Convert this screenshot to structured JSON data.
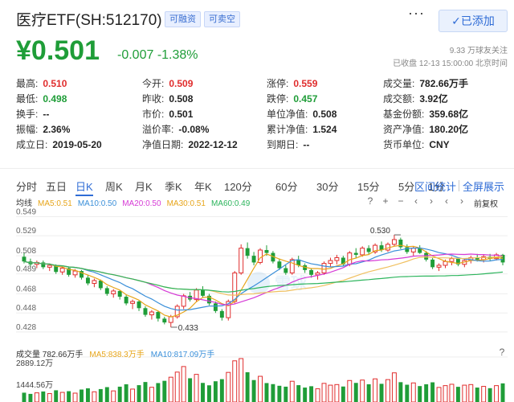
{
  "header": {
    "title": "医疗ETF(SH:512170)",
    "tags": [
      "可融资",
      "可卖空"
    ],
    "more_label": "···",
    "added_label": "✓已添加"
  },
  "quote": {
    "price": "¥0.501",
    "change": "-0.007",
    "change_pct": "-1.38%",
    "followers": "9.33 万球友关注",
    "status": "已收盘 12-13 15:00:00 北京时间"
  },
  "stats": [
    [
      {
        "label": "最高:",
        "value": "0.510",
        "tone": "red"
      },
      {
        "label": "今开:",
        "value": "0.509",
        "tone": "red"
      },
      {
        "label": "涨停:",
        "value": "0.559",
        "tone": "red"
      },
      {
        "label": "成交量:",
        "value": "782.66万手",
        "tone": "dark"
      }
    ],
    [
      {
        "label": "最低:",
        "value": "0.498",
        "tone": "green"
      },
      {
        "label": "昨收:",
        "value": "0.508",
        "tone": "dark"
      },
      {
        "label": "跌停:",
        "value": "0.457",
        "tone": "green"
      },
      {
        "label": "成交额:",
        "value": "3.92亿",
        "tone": "dark"
      }
    ],
    [
      {
        "label": "换手:",
        "value": "--",
        "tone": "dark"
      },
      {
        "label": "市价:",
        "value": "0.501",
        "tone": "dark"
      },
      {
        "label": "单位净值:",
        "value": "0.508",
        "tone": "dark"
      },
      {
        "label": "基金份额:",
        "value": "359.68亿",
        "tone": "dark"
      }
    ],
    [
      {
        "label": "振幅:",
        "value": "2.36%",
        "tone": "dark"
      },
      {
        "label": "溢价率:",
        "value": "-0.08%",
        "tone": "dark"
      },
      {
        "label": "累计净值:",
        "value": "1.524",
        "tone": "dark"
      },
      {
        "label": "资产净值:",
        "value": "180.20亿",
        "tone": "dark"
      }
    ],
    [
      {
        "label": "成立日:",
        "value": "2019-05-20",
        "tone": "dark"
      },
      {
        "label": "净值日期:",
        "value": "2022-12-12",
        "tone": "dark"
      },
      {
        "label": "到期日:",
        "value": "--",
        "tone": "dark"
      },
      {
        "label": "货币单位:",
        "value": "CNY",
        "tone": "dark"
      }
    ]
  ],
  "tabs": [
    "分时",
    "五日",
    "日K",
    "周K",
    "月K",
    "季K",
    "年K",
    "120分",
    "60分",
    "30分",
    "15分",
    "5分",
    "1分"
  ],
  "active_tab": 2,
  "right_tabs": [
    "区间统计",
    "全屏展示"
  ],
  "ma_legend": [
    {
      "label": "均线",
      "color": "#333333"
    },
    {
      "label": "MA5:0.51",
      "color": "#e7a51a"
    },
    {
      "label": "MA10:0.50",
      "color": "#3a8fd9"
    },
    {
      "label": "MA20:0.50",
      "color": "#d63ad6"
    },
    {
      "label": "MA30:0.51",
      "color": "#e7a51a"
    },
    {
      "label": "MA60:0.49",
      "color": "#2db55d"
    }
  ],
  "controls": [
    "?",
    "+",
    "−",
    "‹",
    "›",
    "‹",
    "›"
  ],
  "adjust_label": "前复权",
  "vol_legend": [
    {
      "label": "成交量 782.66万手",
      "color": "#333333"
    },
    {
      "label": "MA5:838.3万手",
      "color": "#e7a51a"
    },
    {
      "label": "MA10:817.09万手",
      "color": "#3a8fd9"
    }
  ],
  "colors": {
    "up": "#e02d2d",
    "down": "#1f9d38",
    "accent": "#2f6cd6"
  },
  "chart_data": {
    "type": "candlestick",
    "y_ticks": [
      "0.549",
      "0.529",
      "0.508",
      "0.489",
      "0.468",
      "0.448",
      "0.428"
    ],
    "ylim": [
      0.422,
      0.552
    ],
    "annotations": [
      {
        "text": "0.530",
        "index": 58,
        "value": 0.53
      },
      {
        "text": "0.433",
        "index": 23,
        "value": 0.433
      }
    ],
    "ohlc": [
      [
        0.507,
        0.511,
        0.5,
        0.502
      ],
      [
        0.502,
        0.505,
        0.496,
        0.499
      ],
      [
        0.499,
        0.503,
        0.495,
        0.501
      ],
      [
        0.501,
        0.503,
        0.494,
        0.496
      ],
      [
        0.496,
        0.5,
        0.492,
        0.498
      ],
      [
        0.498,
        0.499,
        0.489,
        0.491
      ],
      [
        0.491,
        0.497,
        0.488,
        0.495
      ],
      [
        0.495,
        0.496,
        0.486,
        0.488
      ],
      [
        0.488,
        0.494,
        0.485,
        0.492
      ],
      [
        0.492,
        0.493,
        0.483,
        0.485
      ],
      [
        0.485,
        0.488,
        0.477,
        0.479
      ],
      [
        0.479,
        0.484,
        0.475,
        0.482
      ],
      [
        0.482,
        0.483,
        0.472,
        0.474
      ],
      [
        0.474,
        0.476,
        0.466,
        0.468
      ],
      [
        0.468,
        0.473,
        0.464,
        0.471
      ],
      [
        0.471,
        0.472,
        0.462,
        0.465
      ],
      [
        0.465,
        0.467,
        0.456,
        0.458
      ],
      [
        0.458,
        0.462,
        0.452,
        0.46
      ],
      [
        0.46,
        0.461,
        0.45,
        0.453
      ],
      [
        0.453,
        0.455,
        0.444,
        0.446
      ],
      [
        0.446,
        0.451,
        0.441,
        0.449
      ],
      [
        0.449,
        0.45,
        0.439,
        0.442
      ],
      [
        0.442,
        0.444,
        0.436,
        0.438
      ],
      [
        0.438,
        0.446,
        0.433,
        0.444
      ],
      [
        0.444,
        0.457,
        0.442,
        0.455
      ],
      [
        0.455,
        0.468,
        0.452,
        0.466
      ],
      [
        0.466,
        0.47,
        0.46,
        0.462
      ],
      [
        0.462,
        0.474,
        0.46,
        0.472
      ],
      [
        0.472,
        0.476,
        0.464,
        0.466
      ],
      [
        0.466,
        0.468,
        0.456,
        0.458
      ],
      [
        0.458,
        0.46,
        0.448,
        0.45
      ],
      [
        0.45,
        0.452,
        0.44,
        0.443
      ],
      [
        0.443,
        0.462,
        0.44,
        0.46
      ],
      [
        0.46,
        0.492,
        0.458,
        0.49
      ],
      [
        0.49,
        0.52,
        0.488,
        0.516
      ],
      [
        0.516,
        0.522,
        0.505,
        0.508
      ],
      [
        0.508,
        0.512,
        0.498,
        0.501
      ],
      [
        0.501,
        0.516,
        0.499,
        0.514
      ],
      [
        0.514,
        0.519,
        0.508,
        0.511
      ],
      [
        0.511,
        0.513,
        0.5,
        0.502
      ],
      [
        0.502,
        0.505,
        0.493,
        0.495
      ],
      [
        0.495,
        0.498,
        0.488,
        0.49
      ],
      [
        0.49,
        0.506,
        0.488,
        0.504
      ],
      [
        0.504,
        0.508,
        0.496,
        0.498
      ],
      [
        0.498,
        0.5,
        0.49,
        0.493
      ],
      [
        0.493,
        0.495,
        0.485,
        0.488
      ],
      [
        0.488,
        0.492,
        0.483,
        0.49
      ],
      [
        0.49,
        0.502,
        0.488,
        0.5
      ],
      [
        0.5,
        0.506,
        0.496,
        0.503
      ],
      [
        0.503,
        0.509,
        0.499,
        0.506
      ],
      [
        0.506,
        0.508,
        0.497,
        0.499
      ],
      [
        0.499,
        0.513,
        0.497,
        0.511
      ],
      [
        0.511,
        0.516,
        0.506,
        0.509
      ],
      [
        0.509,
        0.518,
        0.507,
        0.516
      ],
      [
        0.516,
        0.519,
        0.509,
        0.512
      ],
      [
        0.512,
        0.521,
        0.51,
        0.519
      ],
      [
        0.519,
        0.523,
        0.512,
        0.514
      ],
      [
        0.514,
        0.522,
        0.512,
        0.52
      ],
      [
        0.52,
        0.53,
        0.518,
        0.525
      ],
      [
        0.525,
        0.527,
        0.515,
        0.517
      ],
      [
        0.517,
        0.52,
        0.51,
        0.512
      ],
      [
        0.512,
        0.518,
        0.508,
        0.516
      ],
      [
        0.516,
        0.519,
        0.51,
        0.511
      ],
      [
        0.511,
        0.513,
        0.502,
        0.504
      ],
      [
        0.504,
        0.506,
        0.494,
        0.496
      ],
      [
        0.496,
        0.5,
        0.492,
        0.498
      ],
      [
        0.498,
        0.504,
        0.495,
        0.502
      ],
      [
        0.502,
        0.507,
        0.498,
        0.505
      ],
      [
        0.505,
        0.506,
        0.497,
        0.499
      ],
      [
        0.499,
        0.505,
        0.496,
        0.503
      ],
      [
        0.503,
        0.508,
        0.5,
        0.506
      ],
      [
        0.506,
        0.51,
        0.502,
        0.504
      ],
      [
        0.504,
        0.509,
        0.501,
        0.507
      ],
      [
        0.507,
        0.51,
        0.503,
        0.505
      ],
      [
        0.505,
        0.511,
        0.503,
        0.509
      ],
      [
        0.509,
        0.51,
        0.498,
        0.501
      ]
    ],
    "volume": {
      "y_ticks": [
        "2889.12万",
        "1444.56万"
      ],
      "ylim": [
        0,
        2889.12
      ],
      "values": [
        620,
        540,
        610,
        700,
        560,
        780,
        640,
        720,
        590,
        830,
        910,
        680,
        860,
        990,
        740,
        1020,
        1180,
        860,
        1120,
        1330,
        980,
        1260,
        1410,
        1650,
        1990,
        2360,
        1580,
        1840,
        1270,
        1110,
        1380,
        1520,
        1970,
        2740,
        2889,
        1980,
        1460,
        1710,
        1260,
        1190,
        1080,
        1020,
        1380,
        1120,
        960,
        1050,
        880,
        1240,
        1120,
        1160,
        1030,
        1430,
        1270,
        1460,
        1180,
        1540,
        1210,
        1490,
        1940,
        1320,
        1150,
        1270,
        1060,
        1180,
        1310,
        970,
        1090,
        1180,
        1010,
        1120,
        1160,
        960,
        1040,
        920,
        1090,
        1240
      ]
    }
  }
}
